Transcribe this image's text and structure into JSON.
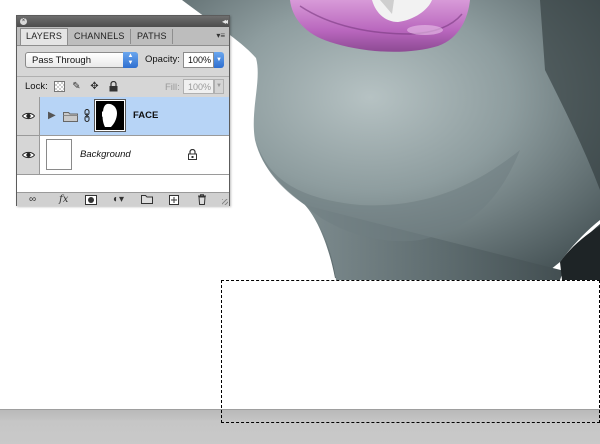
{
  "panel": {
    "tabs": [
      {
        "label": "LAYERS",
        "active": true
      },
      {
        "label": "CHANNELS",
        "active": false
      },
      {
        "label": "PATHS",
        "active": false
      }
    ],
    "blend_mode": "Pass Through",
    "opacity_label": "Opacity:",
    "opacity_value": "100%",
    "lock_label": "Lock:",
    "fill_label": "Fill:",
    "fill_value": "100%",
    "layers": [
      {
        "name": "FACE",
        "type": "group",
        "visible": true,
        "selected": true,
        "has_mask": true
      },
      {
        "name": "Background",
        "type": "background",
        "visible": true,
        "selected": false,
        "locked": true
      }
    ],
    "footer_icons": [
      "link-layers-icon",
      "fx-icon",
      "add-mask-icon",
      "adjustment-layer-icon",
      "new-group-icon",
      "new-layer-icon",
      "trash-icon"
    ]
  },
  "colors": {
    "selected_row": "#b7d4f6",
    "lip_color": "#c27bc3",
    "skin_tone": "#8a9a9c"
  }
}
